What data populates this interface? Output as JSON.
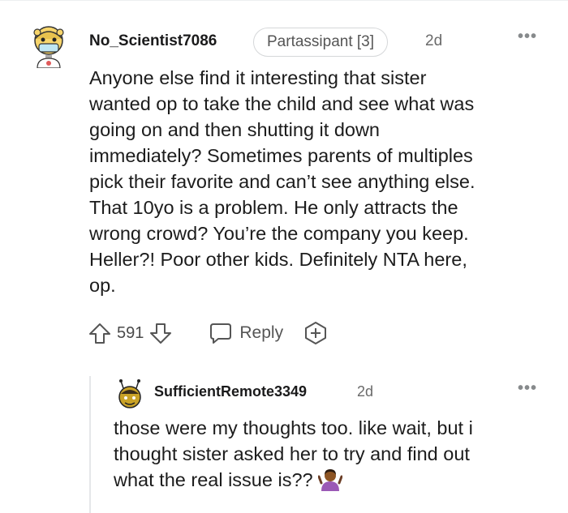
{
  "comment": {
    "author": "No_Scientist7086",
    "flair": "Partassipant [3]",
    "time": "2d",
    "more_label": "•••",
    "lines": [
      "Anyone else find it interesting that sister",
      "wanted op to take the child and see what was",
      "going on and then shutting it down",
      "immediately? Sometimes parents of multiples",
      "pick their favorite and can’t see anything else.",
      "That 10yo is a problem. He only attracts the",
      "wrong crowd? You’re the company you keep.",
      "Heller?! Poor other kids. Definitely NTA here,",
      "op."
    ],
    "votes": "591",
    "reply_label": "Reply"
  },
  "reply": {
    "author": "SufficientRemote3349",
    "time": "2d",
    "more_label": "•••",
    "lines": [
      "those were my thoughts too. like wait, but i",
      "thought sister asked her to try and find out",
      "what the real issue is??"
    ],
    "emoji_name": "person-shrugging-emoji"
  },
  "colors": {
    "text": "#1a1a1b",
    "meta": "#878a8c",
    "thread": "#e5e7e9"
  }
}
